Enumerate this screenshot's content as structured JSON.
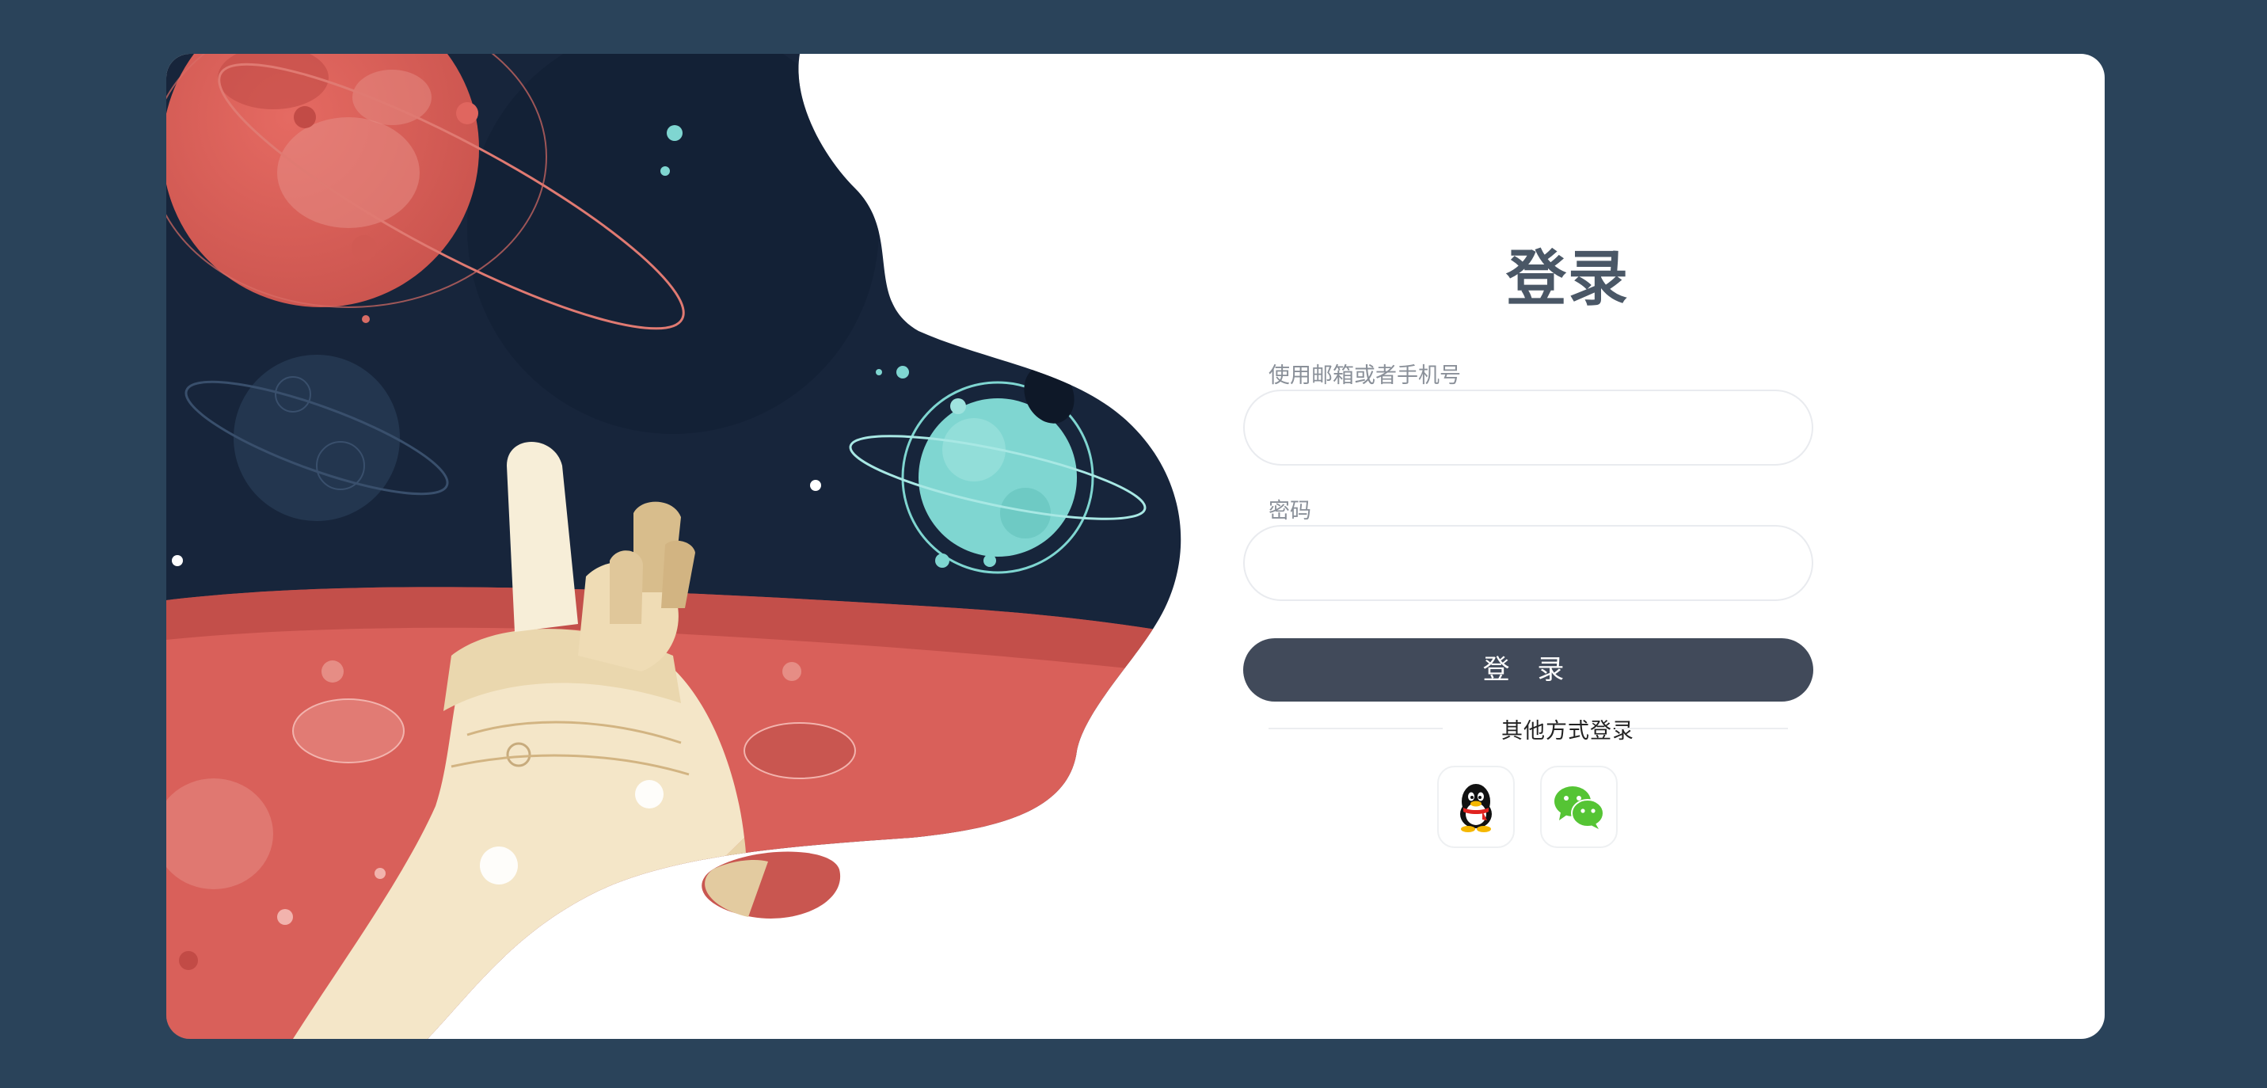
{
  "form": {
    "title": "登录",
    "email_label": "使用邮箱或者手机号",
    "email_value": "",
    "password_label": "密码",
    "password_value": "",
    "login_button": "登 录",
    "other_methods": "其他方式登录"
  },
  "social": [
    {
      "name": "qq",
      "icon": "qq-penguin-icon"
    },
    {
      "name": "wechat",
      "icon": "wechat-icon"
    }
  ],
  "colors": {
    "background": "#2a435a",
    "card": "#ffffff",
    "button": "#414a5a",
    "title": "#4a5766",
    "space": "#17253b",
    "mars": "#d9605a",
    "teal_planet": "#7fd6d1",
    "wechat_green": "#55c434"
  }
}
